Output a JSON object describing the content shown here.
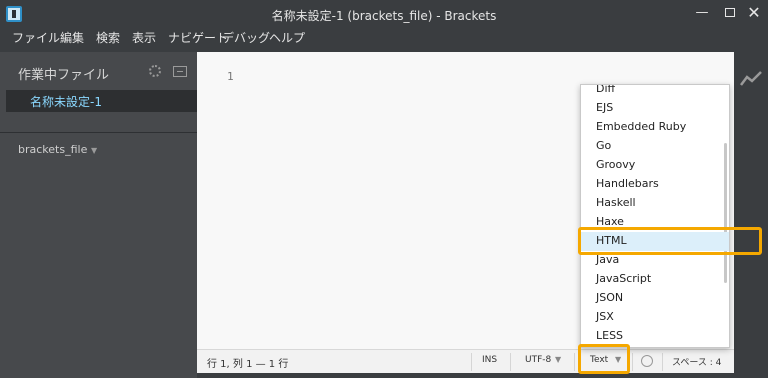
{
  "window": {
    "title": "名称未設定-1 (brackets_file) - Brackets",
    "minimize": "—",
    "close": "✕"
  },
  "menu": [
    "ファイル",
    "編集",
    "検索",
    "表示",
    "ナビゲート",
    "デバッグ",
    "ヘルプ"
  ],
  "sidebar": {
    "working_files_header": "作業中ファイル",
    "working_file": "名称未設定-1",
    "project_name": "brackets_file",
    "project_caret": "▼"
  },
  "editor": {
    "line_number": "1"
  },
  "statusbar": {
    "cursor": "行 1, 列 1 — 1 行",
    "ins": "INS",
    "encoding": "UTF-8",
    "encoding_caret": "▼",
    "language": "Text",
    "language_caret": "▼",
    "indent": "スペース : 4"
  },
  "language_dropdown": {
    "items": [
      "Diff",
      "EJS",
      "Embedded Ruby",
      "Go",
      "Groovy",
      "Handlebars",
      "Haskell",
      "Haxe",
      "HTML",
      "Java",
      "JavaScript",
      "JSON",
      "JSX",
      "LESS"
    ],
    "highlighted": "HTML"
  },
  "colors": {
    "accent_highlight": "#f5a800",
    "working_file_text": "#8ad8ff",
    "selected_item_bg": "#dceffa"
  },
  "icons": {
    "app": "brackets-app-icon",
    "gear": "gear-icon",
    "split": "split-view-icon",
    "live_preview": "live-preview-icon",
    "lint": "linter-status-icon"
  }
}
